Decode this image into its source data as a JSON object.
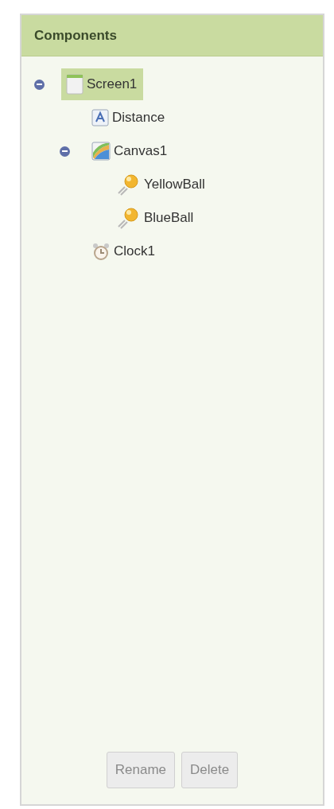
{
  "panel": {
    "title": "Components"
  },
  "tree": [
    {
      "label": "Screen1",
      "kind": "screen",
      "selected": true,
      "expanded": true,
      "children": [
        {
          "label": "Distance",
          "kind": "label",
          "selected": false
        },
        {
          "label": "Canvas1",
          "kind": "canvas",
          "selected": false,
          "expanded": true,
          "children": [
            {
              "label": "YellowBall",
              "kind": "ball",
              "selected": false
            },
            {
              "label": "BlueBall",
              "kind": "ball",
              "selected": false
            }
          ]
        },
        {
          "label": "Clock1",
          "kind": "clock",
          "selected": false
        }
      ]
    }
  ],
  "buttons": [
    {
      "label": "Rename",
      "disabled": true
    },
    {
      "label": "Delete",
      "disabled": true
    }
  ]
}
